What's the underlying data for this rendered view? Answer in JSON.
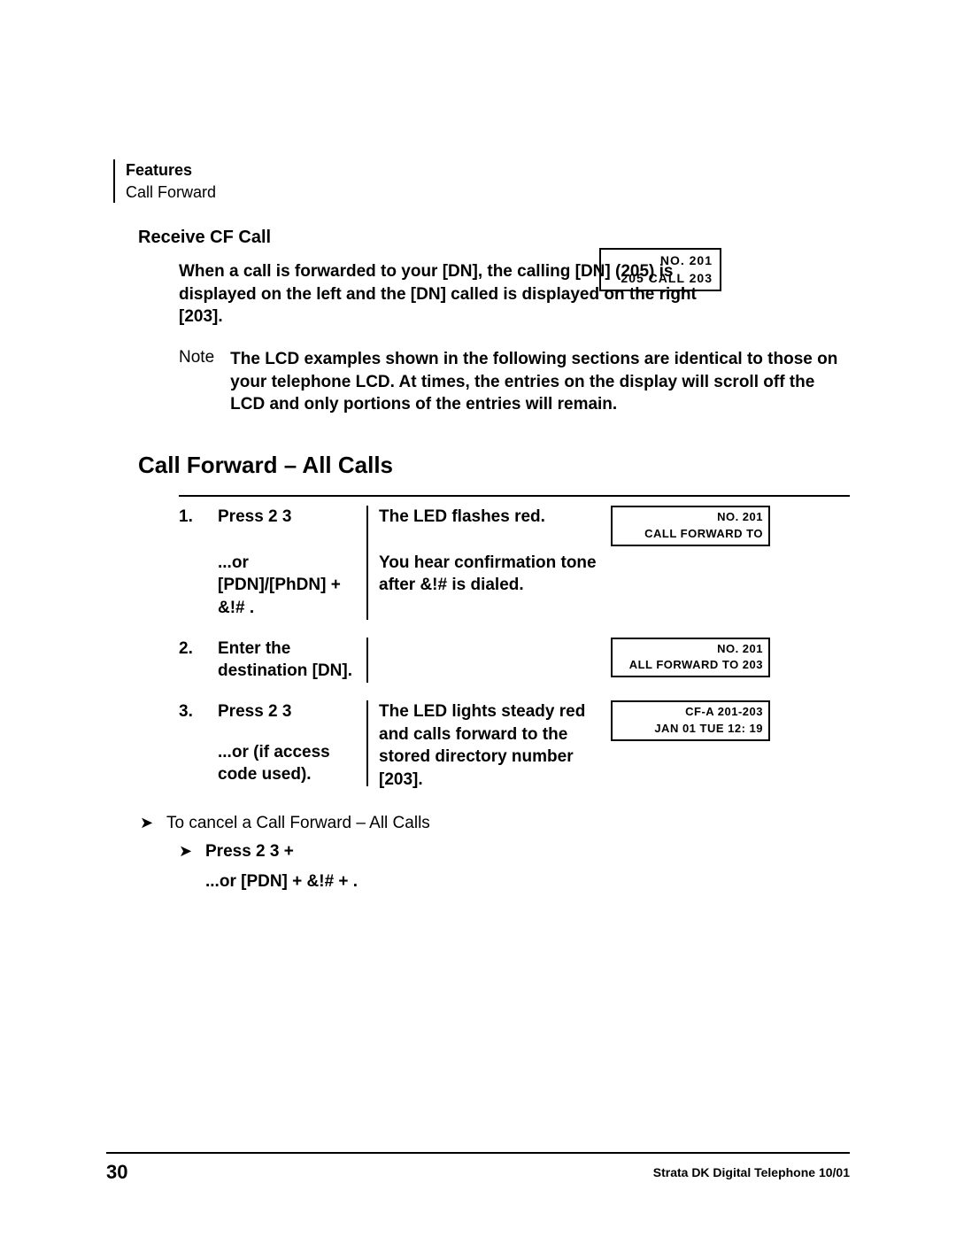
{
  "header": {
    "features_label": "Features",
    "section_label": "Call Forward"
  },
  "receive_cf": {
    "title": "Receive CF Call",
    "para": "When a call is forwarded to your [DN], the calling [DN] (205) is displayed on the left and the [DN] called is displayed on the right [203].",
    "lcd_line1": "NO. 201",
    "lcd_line2": "205 CALL 203"
  },
  "note": {
    "label": "Note",
    "text": "The LCD examples shown in the following sections are identical to those on your telephone LCD. At times, the entries on the display will scroll off the LCD and only portions of the entries will remain."
  },
  "cf_all": {
    "title": "Call Forward – All Calls",
    "steps": [
      {
        "num": "1.",
        "action_line1": "Press 2 3",
        "action_line2": "...or [PDN]/[PhDN] + &!#  .",
        "result_line1": "The LED flashes red.",
        "result_line2": "You hear confirmation tone after &!#   is dialed.",
        "lcd_line1": "NO. 201",
        "lcd_line2": "CALL FORWARD TO"
      },
      {
        "num": "2.",
        "action_line1": "Enter the destination [DN].",
        "action_line2": "",
        "result_line1": "",
        "result_line2": "",
        "lcd_line1": "NO. 201",
        "lcd_line2": "ALL FORWARD TO 203"
      },
      {
        "num": "3.",
        "action_line1": "Press 2 3",
        "action_line2": "...or        (if access code used).",
        "result_line1": "The LED lights steady red and calls forward to the stored directory number [203].",
        "result_line2": "",
        "lcd_line1": "CF-A 201-203",
        "lcd_line2": "JAN 01 TUE 12: 19"
      }
    ]
  },
  "cancel": {
    "intro": "To cancel a Call Forward – All Calls",
    "line1": "Press   2 3               +",
    "line2": "...or [PDN] + &!#   +        ."
  },
  "footer": {
    "page": "30",
    "pub": "Strata DK Digital Telephone   10/01"
  }
}
